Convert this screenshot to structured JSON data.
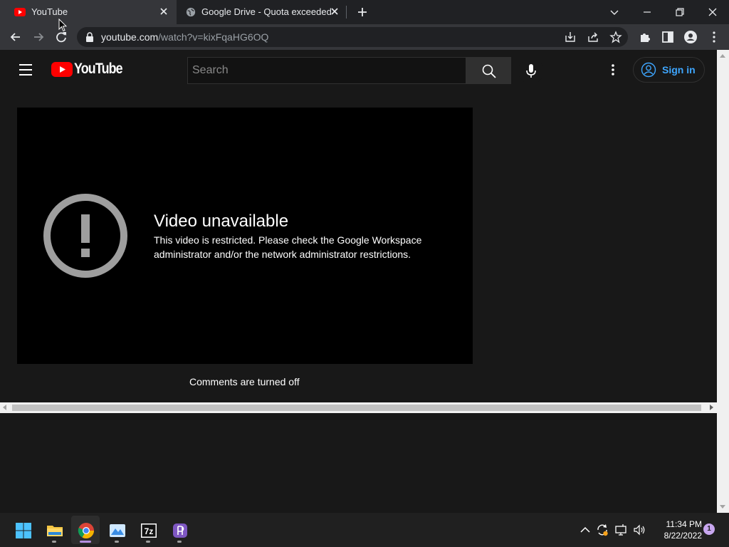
{
  "browser": {
    "tabs": [
      {
        "title": "YouTube",
        "active": true
      },
      {
        "title": "Google Drive - Quota exceeded",
        "active": false
      }
    ],
    "address": {
      "host": "youtube.com",
      "path": "/watch?v=kixFqaHG6OQ"
    }
  },
  "youtube": {
    "wordmark": "YouTube",
    "search_placeholder": "Search",
    "signin_label": "Sign in",
    "player": {
      "error_title": "Video unavailable",
      "error_message": "This video is restricted. Please check the Google Workspace administrator and/or the network administrator restrictions."
    },
    "comments_status": "Comments are turned off"
  },
  "taskbar": {
    "apps": [
      "start",
      "file-explorer",
      "chrome",
      "photos",
      "7zip",
      "app-p"
    ],
    "active_app": "chrome",
    "time": "11:34 PM",
    "date": "8/22/2022",
    "notification_count": "1"
  },
  "colors": {
    "youtube_red": "#ff0000",
    "link_blue": "#3ea6ff",
    "page_bg": "#181818",
    "player_bg": "#000000"
  }
}
